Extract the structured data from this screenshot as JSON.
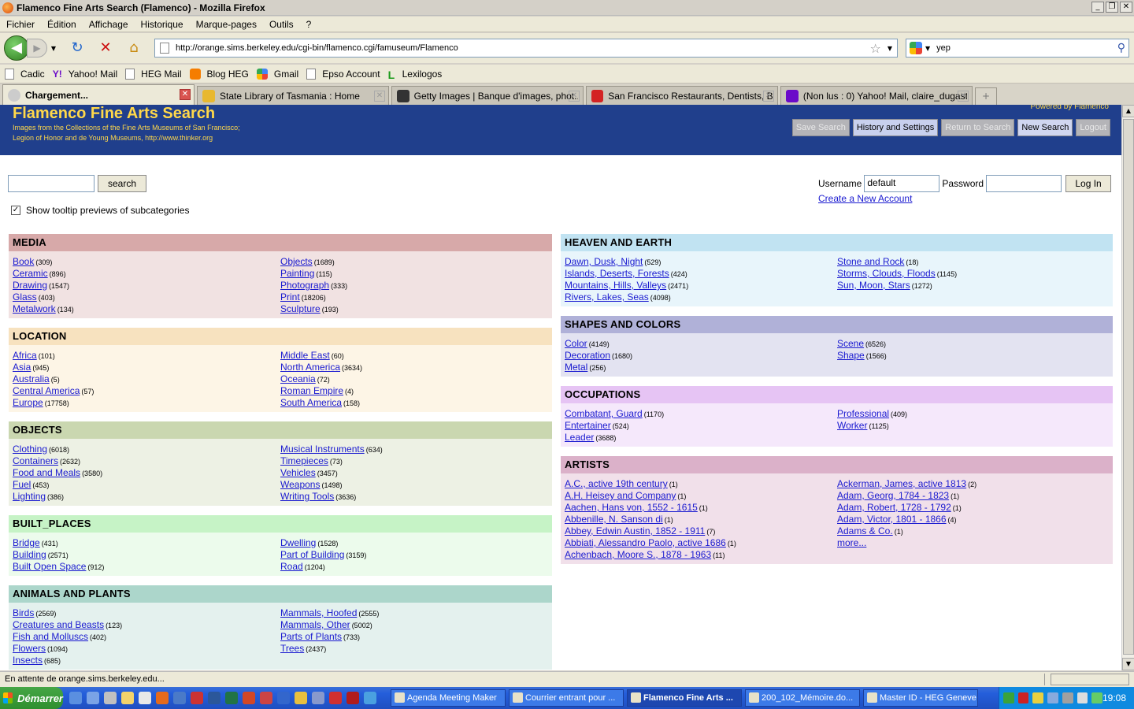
{
  "window": {
    "title": "Flamenco Fine Arts Search (Flamenco) - Mozilla Firefox",
    "minimize": "_",
    "maximize": "❐",
    "close": "✕"
  },
  "menu": [
    "Fichier",
    "Édition",
    "Affichage",
    "Historique",
    "Marque-pages",
    "Outils",
    "?"
  ],
  "nav": {
    "url": "http://orange.sims.berkeley.edu/cgi-bin/flamenco.cgi/famuseum/Flamenco",
    "search_value": "yep"
  },
  "bookmarks": [
    {
      "label": "Cadic",
      "icon": "page-icon"
    },
    {
      "label": "Yahoo! Mail",
      "icon": "yahoo-icon"
    },
    {
      "label": "HEG Mail",
      "icon": "page-icon"
    },
    {
      "label": "Blog HEG",
      "icon": "blogger-icon"
    },
    {
      "label": "Gmail",
      "icon": "google-icon"
    },
    {
      "label": "Epso Account",
      "icon": "page-icon"
    },
    {
      "label": "Lexilogos",
      "icon": "lexilogos-icon"
    }
  ],
  "tabs": [
    {
      "label": "Chargement...",
      "active": true,
      "color": "#cccccc"
    },
    {
      "label": "State Library of Tasmania : Home",
      "active": false,
      "color": "#e8b830"
    },
    {
      "label": "Getty Images | Banque d'images, phot...",
      "active": false,
      "color": "#333333"
    },
    {
      "label": "San Francisco Restaurants, Dentists, B...",
      "active": false,
      "color": "#d32323"
    },
    {
      "label": "(Non lus : 0) Yahoo! Mail, claire_dugast",
      "active": false,
      "color": "#6b0ac9"
    }
  ],
  "header": {
    "title": "Flamenco Fine Arts Search",
    "sub1": "Images from the Collections of the Fine Arts Museums of San Francisco;",
    "sub2": "Legion of Honor and de Young Museums, http://www.thinker.org",
    "powered": "Powered by Flamenco",
    "buttons": {
      "save": "Save Search",
      "history": "History and Settings",
      "return": "Return to Search",
      "new": "New Search",
      "logout": "Logout"
    }
  },
  "search": {
    "button": "search",
    "tooltip_label": "Show tooltip previews of subcategories"
  },
  "login": {
    "username_label": "Username",
    "username_value": "default",
    "password_label": "Password",
    "button": "Log In",
    "create": "Create a New Account"
  },
  "facets_left": [
    {
      "title": "MEDIA",
      "head": "#d7a9a9",
      "body": "#f1e2e2",
      "col1": [
        [
          "Book",
          "(309)"
        ],
        [
          "Ceramic",
          "(896)"
        ],
        [
          "Drawing",
          "(1547)"
        ],
        [
          "Glass",
          "(403)"
        ],
        [
          "Metalwork",
          "(134)"
        ]
      ],
      "col2": [
        [
          "Objects",
          "(1689)"
        ],
        [
          "Painting",
          "(115)"
        ],
        [
          "Photograph",
          "(333)"
        ],
        [
          "Print",
          "(18206)"
        ],
        [
          "Sculpture",
          "(193)"
        ]
      ]
    },
    {
      "title": "LOCATION",
      "head": "#f7e2bf",
      "body": "#fdf5e6",
      "col1": [
        [
          "Africa",
          "(101)"
        ],
        [
          "Asia",
          "(945)"
        ],
        [
          "Australia",
          "(5)"
        ],
        [
          "Central America",
          "(57)"
        ],
        [
          "Europe",
          "(17758)"
        ]
      ],
      "col2": [
        [
          "Middle East",
          "(60)"
        ],
        [
          "North America",
          "(3634)"
        ],
        [
          "Oceania",
          "(72)"
        ],
        [
          "Roman Empire",
          "(4)"
        ],
        [
          "South America",
          "(158)"
        ]
      ]
    },
    {
      "title": "OBJECTS",
      "head": "#cad7b0",
      "body": "#edf1e4",
      "col1": [
        [
          "Clothing",
          "(6018)"
        ],
        [
          "Containers",
          "(2632)"
        ],
        [
          "Food and Meals",
          "(3580)"
        ],
        [
          "Fuel",
          "(453)"
        ],
        [
          "Lighting",
          "(386)"
        ]
      ],
      "col2": [
        [
          "Musical Instruments",
          "(634)"
        ],
        [
          "Timepieces",
          "(73)"
        ],
        [
          "Vehicles",
          "(3457)"
        ],
        [
          "Weapons",
          "(1498)"
        ],
        [
          "Writing Tools",
          "(3636)"
        ]
      ]
    },
    {
      "title": "BUILT_PLACES",
      "head": "#c6f3c6",
      "body": "#ecfbec",
      "col1": [
        [
          "Bridge",
          "(431)"
        ],
        [
          "Building",
          "(2571)"
        ],
        [
          "Built Open Space",
          "(912)"
        ]
      ],
      "col2": [
        [
          "Dwelling",
          "(1528)"
        ],
        [
          "Part of Building",
          "(3159)"
        ],
        [
          "Road",
          "(1204)"
        ]
      ]
    },
    {
      "title": "ANIMALS AND PLANTS",
      "head": "#acd6cb",
      "body": "#e4f1ee",
      "col1": [
        [
          "Birds",
          "(2569)"
        ],
        [
          "Creatures and Beasts",
          "(123)"
        ],
        [
          "Fish and Molluscs",
          "(402)"
        ],
        [
          "Flowers",
          "(1094)"
        ],
        [
          "Insects",
          "(685)"
        ]
      ],
      "col2": [
        [
          "Mammals, Hoofed",
          "(2555)"
        ],
        [
          "Mammals, Other",
          "(5002)"
        ],
        [
          "Parts of Plants",
          "(733)"
        ],
        [
          "Trees",
          "(2437)"
        ]
      ]
    }
  ],
  "facets_right": [
    {
      "title": "HEAVEN AND EARTH",
      "head": "#c1e3f2",
      "body": "#e8f5fb",
      "col1": [
        [
          "Dawn, Dusk, Night",
          "(529)"
        ],
        [
          "Islands, Deserts, Forests",
          "(424)"
        ],
        [
          "Mountains, Hills, Valleys",
          "(2471)"
        ],
        [
          "Rivers, Lakes, Seas",
          "(4098)"
        ]
      ],
      "col2": [
        [
          "Stone and Rock",
          "(18)"
        ],
        [
          "Storms, Clouds, Floods",
          "(1145)"
        ],
        [
          "Sun, Moon, Stars",
          "(1272)"
        ]
      ]
    },
    {
      "title": "SHAPES AND COLORS",
      "head": "#b0b1d8",
      "body": "#e3e3f1",
      "col1": [
        [
          "Color",
          "(4149)"
        ],
        [
          "Decoration",
          "(1680)"
        ],
        [
          "Metal",
          "(256)"
        ]
      ],
      "col2": [
        [
          "Scene",
          "(6526)"
        ],
        [
          "Shape",
          "(1566)"
        ]
      ]
    },
    {
      "title": "OCCUPATIONS",
      "head": "#e6c4f4",
      "body": "#f5e8fb",
      "col1": [
        [
          "Combatant, Guard",
          "(1170)"
        ],
        [
          "Entertainer",
          "(524)"
        ],
        [
          "Leader",
          "(3688)"
        ]
      ],
      "col2": [
        [
          "Professional",
          "(409)"
        ],
        [
          "Worker",
          "(1125)"
        ]
      ]
    },
    {
      "title": "ARTISTS",
      "head": "#dbb1c9",
      "body": "#f1e0ea",
      "col1": [
        [
          "A.C., active 19th century",
          "(1)"
        ],
        [
          "A.H. Heisey and Company",
          "(1)"
        ],
        [
          "Aachen, Hans von, 1552 - 1615",
          "(1)"
        ],
        [
          "Abbenille, N. Sanson di",
          "(1)"
        ],
        [
          "Abbey, Edwin Austin, 1852 - 1911",
          "(7)"
        ],
        [
          "Abbiati, Alessandro Paolo, active 1686",
          "(1)"
        ],
        [
          "Achenbach, Moore S., 1878 - 1963",
          "(11)"
        ]
      ],
      "col2": [
        [
          "Ackerman, James, active 1813",
          "(2)"
        ],
        [
          "Adam, Georg, 1784 - 1823",
          "(1)"
        ],
        [
          "Adam, Robert, 1728 - 1792",
          "(1)"
        ],
        [
          "Adam, Victor, 1801 - 1866",
          "(4)"
        ],
        [
          "Adams & Co.",
          "(1)"
        ],
        [
          "more...",
          ""
        ]
      ]
    }
  ],
  "status": {
    "text": "En attente de orange.sims.berkeley.edu..."
  },
  "taskbar": {
    "start": "Démarrer",
    "tasks": [
      {
        "label": "Agenda Meeting Maker",
        "active": false
      },
      {
        "label": "Courrier entrant pour ...",
        "active": false
      },
      {
        "label": "Flamenco Fine Arts ...",
        "active": true
      },
      {
        "label": "200_102_Mémoire.do...",
        "active": false
      },
      {
        "label": "Master ID - HEG Geneve",
        "active": false
      }
    ],
    "clock": "19:08"
  }
}
